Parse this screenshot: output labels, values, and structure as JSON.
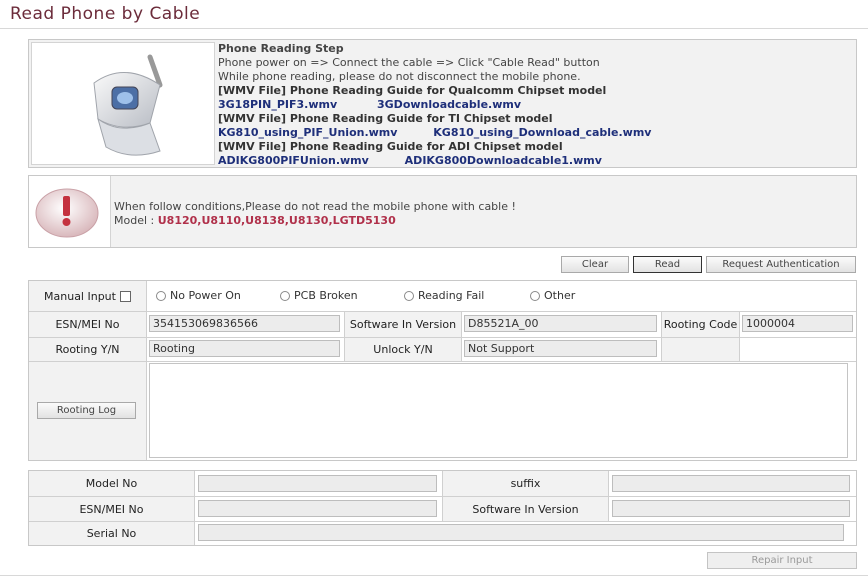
{
  "page": {
    "title": "Read Phone by Cable"
  },
  "guide": {
    "step_title": "Phone Reading Step",
    "step_line1": "Phone power on => Connect the cable => Click \"Cable Read\" button",
    "step_line2": "While phone reading, please do not disconnect the mobile phone.",
    "sections": [
      {
        "heading": "[WMV File] Phone Reading Guide for Qualcomm Chipset model",
        "links": [
          "3G18PIN_PIF3.wmv",
          "3GDownloadcable.wmv"
        ]
      },
      {
        "heading": "[WMV File] Phone Reading Guide for TI Chipset model",
        "links": [
          "KG810_using_PIF_Union.wmv",
          "KG810_using_Download_cable.wmv"
        ]
      },
      {
        "heading": "[WMV File] Phone Reading Guide for ADI Chipset model",
        "links": [
          "ADIKG800PIFUnion.wmv",
          "ADIKG800Downloadcable1.wmv"
        ]
      }
    ]
  },
  "warning": {
    "message": "When follow conditions,Please do not read the mobile phone with cable !",
    "model_label": "Model :",
    "models": "U8120,U8110,U8138,U8130,LGTD5130"
  },
  "actions": {
    "clear": "Clear",
    "read": "Read",
    "auth": "Request Authentication"
  },
  "form": {
    "manual_input_label": "Manual Input",
    "radios": [
      "No Power On",
      "PCB Broken",
      "Reading Fail",
      "Other"
    ],
    "esn_label": "ESN/MEI No",
    "esn_value": "354153069836566",
    "sw_label": "Software In Version",
    "sw_value": "D85521A_00",
    "rooting_code_label": "Rooting Code",
    "rooting_code_value": "1000004",
    "rooting_yn_label": "Rooting Y/N",
    "rooting_yn_value": "Rooting",
    "unlock_label": "Unlock Y/N",
    "unlock_value": "Not Support",
    "rooting_log_button": "Rooting Log"
  },
  "repair": {
    "model_no_label": "Model No",
    "suffix_label": "suffix",
    "esn_label": "ESN/MEI No",
    "sw_label": "Software In Version",
    "serial_label": "Serial No",
    "repair_input_button": "Repair Input"
  },
  "icons": {
    "phone": "flip-phone-image",
    "warning": "exclamation-warning-icon"
  },
  "colors": {
    "title": "#6b2b3a",
    "links": "#1e2f7a",
    "warning_models": "#b0304a"
  }
}
